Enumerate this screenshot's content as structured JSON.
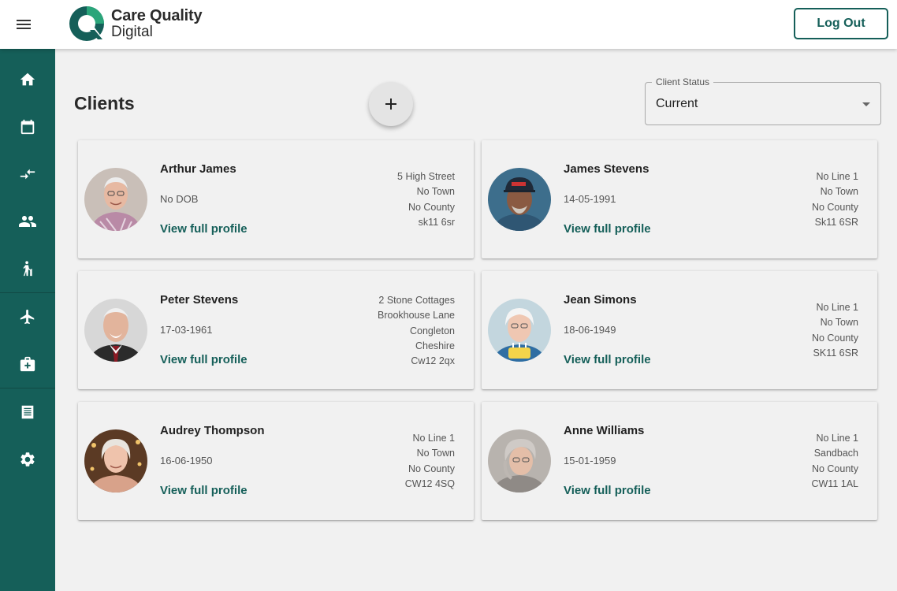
{
  "header": {
    "logo_line1": "Care Quality",
    "logo_line2": "Digital",
    "logout_label": "Log Out"
  },
  "sidebar": {
    "items": [
      {
        "icon": "home-icon"
      },
      {
        "icon": "calendar-icon"
      },
      {
        "icon": "swap-arrows-icon"
      },
      {
        "icon": "people-icon"
      },
      {
        "icon": "elderly-person-icon"
      },
      {
        "icon": "airplane-icon"
      },
      {
        "icon": "medical-bag-icon"
      },
      {
        "icon": "notes-icon"
      },
      {
        "icon": "gear-icon"
      }
    ]
  },
  "main": {
    "title": "Clients",
    "add_button_icon": "plus-icon",
    "status_filter": {
      "label": "Client Status",
      "value": "Current"
    },
    "clients": [
      {
        "name": "Arthur James",
        "dob": "No DOB",
        "link": "View full profile",
        "address": [
          "5 High Street",
          "No Town",
          "No County",
          "sk11 6sr"
        ]
      },
      {
        "name": "James Stevens",
        "dob": "14-05-1991",
        "link": "View full profile",
        "address": [
          "No Line 1",
          "No Town",
          "No County",
          "Sk11 6SR"
        ]
      },
      {
        "name": "Peter Stevens",
        "dob": "17-03-1961",
        "link": "View full profile",
        "address": [
          "2 Stone Cottages",
          "Brookhouse Lane",
          "Congleton",
          "Cheshire",
          "Cw12 2qx"
        ]
      },
      {
        "name": "Jean Simons",
        "dob": "18-06-1949",
        "link": "View full profile",
        "address": [
          "No Line 1",
          "No Town",
          "No County",
          "SK11 6SR"
        ]
      },
      {
        "name": "Audrey Thompson",
        "dob": "16-06-1950",
        "link": "View full profile",
        "address": [
          "No Line 1",
          "No Town",
          "No County",
          "CW12 4SQ"
        ]
      },
      {
        "name": "Anne Williams",
        "dob": "15-01-1959",
        "link": "View full profile",
        "address": [
          "No Line 1",
          "Sandbach",
          "No County",
          "CW11 1AL"
        ]
      }
    ]
  },
  "colors": {
    "brand": "#155f59",
    "background": "#f1f1f1",
    "logo_light": "#2aa57a"
  }
}
